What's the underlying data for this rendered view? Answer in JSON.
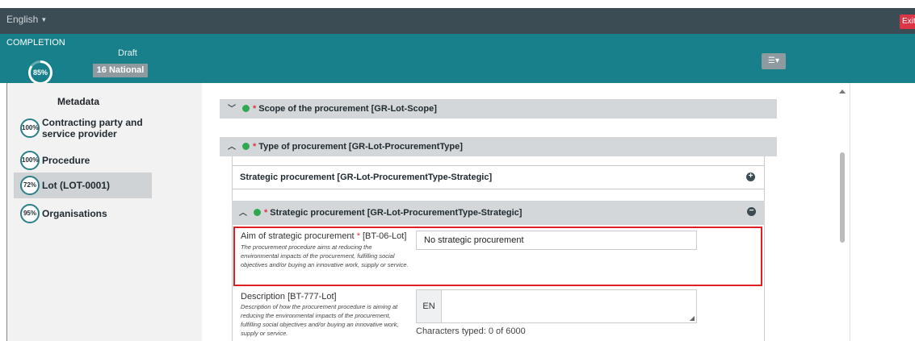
{
  "topbar": {
    "language": "English",
    "exit_label": "Exit"
  },
  "status": {
    "completion_label": "COMPLETION",
    "completion_pct": "85%",
    "completion_value": 0.85,
    "draft_label": "Draft",
    "national_badge": "16 National"
  },
  "sidebar": {
    "metadata": "Metadata",
    "items": [
      {
        "pct": "100%",
        "label": "Contracting party and",
        "label2": "service provider"
      },
      {
        "pct": "100%",
        "label": "Procedure"
      },
      {
        "pct": "72%",
        "label": "Lot (LOT-0001)"
      },
      {
        "pct": "95%",
        "label": "Organisations"
      }
    ]
  },
  "main": {
    "scope": "Scope of the procurement  [GR-Lot-Scope]",
    "type": "Type of procurement  [GR-Lot-ProcurementType]",
    "strategic_collapsed": "Strategic procurement  [GR-Lot-ProcurementType-Strategic]",
    "strategic_open": "Strategic procurement  [GR-Lot-ProcurementType-Strategic]",
    "aim_label": "Aim of strategic procurement",
    "aim_code": "[BT-06-Lot]",
    "aim_help": "The procurement procedure aims at reducing the environmental impacts of the procurement, fulfilling social objectives and/or buying an innovative work, supply or service.",
    "aim_value": "No strategic procurement",
    "desc_label": "Description [BT-777-Lot]",
    "desc_help": "Description of how the procurement procedure is aiming at reducing the environmental impacts of the procurement, fulfilling social objectives and/or buying an innovative work, supply or service.",
    "lang_code": "EN",
    "chars_typed": "Characters typed: 0 of 6000"
  }
}
